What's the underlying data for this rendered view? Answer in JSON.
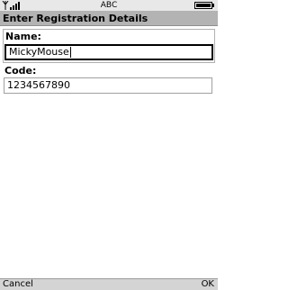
{
  "status_bar": {
    "mode": "ABC",
    "icons": [
      "signal-strength-icon",
      "battery-icon"
    ]
  },
  "title_bar": {
    "title": "Enter Registration Details"
  },
  "form": {
    "name": {
      "label": "Name:",
      "value": "MickyMouse",
      "focused": true
    },
    "code": {
      "label": "Code:",
      "value": "1234567890",
      "focused": false
    }
  },
  "softkeys": {
    "left": "Cancel",
    "right": "OK"
  },
  "colors": {
    "title_bar_bg": "#b3b3b3",
    "status_bar_bg": "#e8e8e8",
    "softkey_bg": "#d4d4d4",
    "focus_border": "#000000"
  }
}
